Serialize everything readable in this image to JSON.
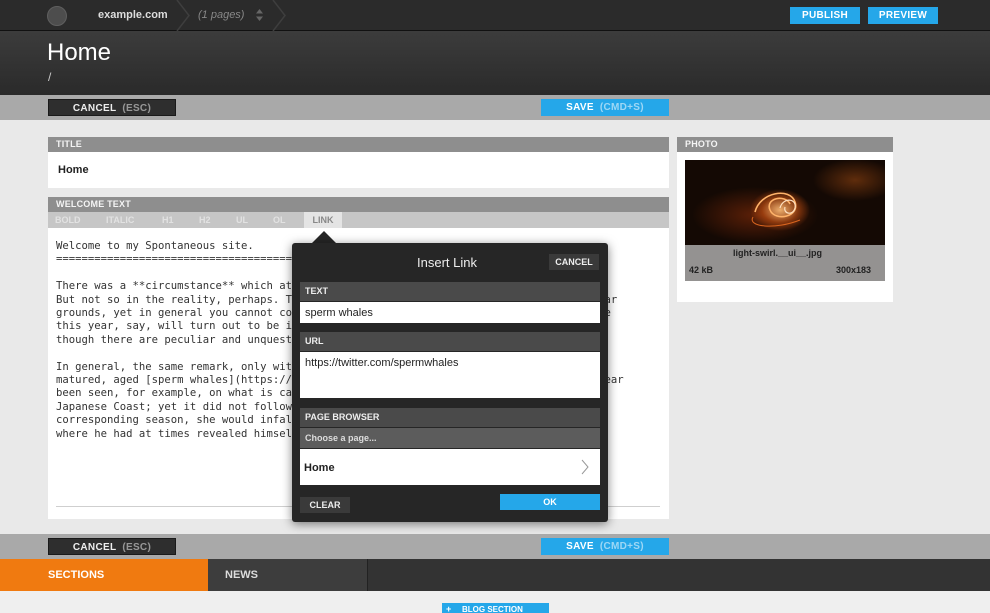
{
  "topbar": {
    "site": "example.com",
    "pages_count": "(1 pages)",
    "publish_label": "PUBLISH",
    "preview_label": "PREVIEW"
  },
  "header": {
    "title": "Home",
    "path": "/"
  },
  "toolbar": {
    "cancel_label": "CANCEL",
    "cancel_shortcut": "(ESC)",
    "save_label": "SAVE",
    "save_shortcut": "(CMD+S)"
  },
  "title_panel": {
    "label": "TITLE",
    "value": "Home"
  },
  "welcome_panel": {
    "label": "WELCOME TEXT",
    "format_buttons": [
      "BOLD",
      "ITALIC",
      "H1",
      "H2",
      "UL",
      "OL",
      "LINK"
    ],
    "content": "Welcome to my Spontaneous site.\n============================================\n\nThere was a **circumstance** which at first                                    scheme.\nBut not so in the reality, perhaps. Though th                                  articular\ngrounds, yet in general you cannot conclude                                    ongitude\nthis year, say, will turn out to be identically                                ason;\nthough there are peculiar and unquestionab\n\nIn general, the same remark, only within a le                                  he\nmatured, aged [sperm whales](https://twitte                                    ormer year\nbeen seen, for example, on what is called th                                   he\nJapanese Coast; yet it did not follow, that w                                  ent\ncorresponding season, she would infallibly e                                   nds,\nwhere he had at times revealed himself."
  },
  "photo_panel": {
    "label": "PHOTO",
    "filename": "light-swirl.__ui__.jpg",
    "size": "42 kB",
    "dimensions": "300x183"
  },
  "insert_link": {
    "title": "Insert Link",
    "cancel_label": "CANCEL",
    "text_label": "TEXT",
    "text_value": "sperm whales",
    "url_label": "URL",
    "url_value": "https://twitter.com/spermwhales",
    "browser_label": "PAGE BROWSER",
    "choose_placeholder": "Choose a page...",
    "page_item": "Home",
    "clear_label": "CLEAR",
    "ok_label": "OK"
  },
  "tabs": {
    "sections": "SECTIONS",
    "news": "NEWS"
  },
  "footer": {
    "blog_button": "BLOG SECTION"
  },
  "colors": {
    "accent": "#25a7e9",
    "tab_active": "#f07a10"
  }
}
